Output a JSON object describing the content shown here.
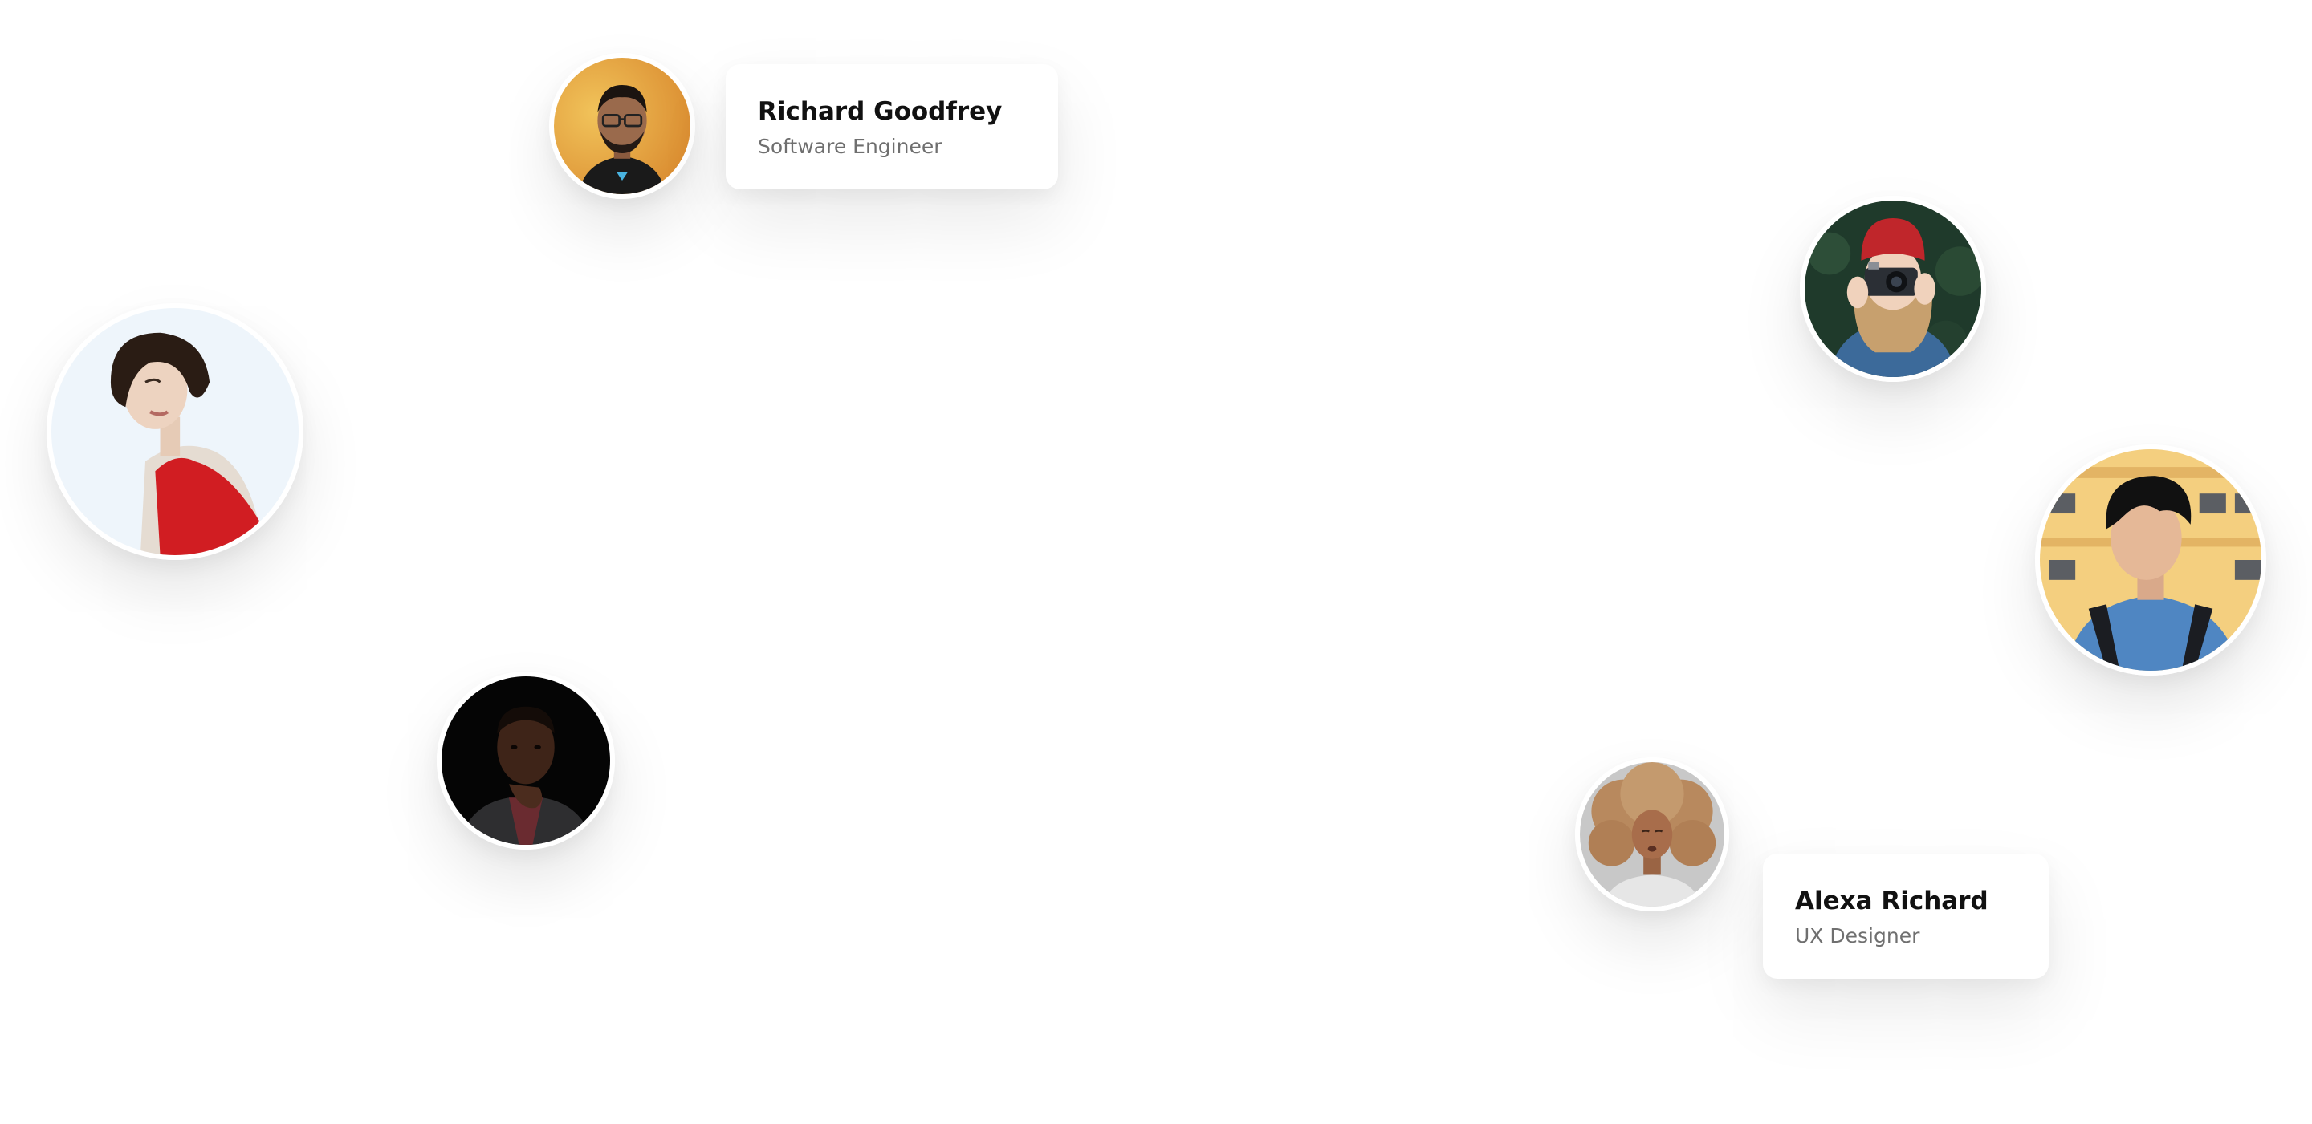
{
  "profiles": {
    "richard": {
      "name": "Richard Goodfrey",
      "role": "Software Engineer"
    },
    "alexa": {
      "name": "Alexa Richard",
      "role": "UX Designer"
    }
  },
  "avatars": [
    "avatar-richard-goodfrey",
    "avatar-woman-red-top",
    "avatar-man-dark-background",
    "avatar-woman-with-camera",
    "avatar-man-blue-shirt",
    "avatar-alexa-richard"
  ],
  "colors": {
    "background": "#ffffff",
    "name_text": "#111111",
    "role_text": "#6f6f6f"
  }
}
